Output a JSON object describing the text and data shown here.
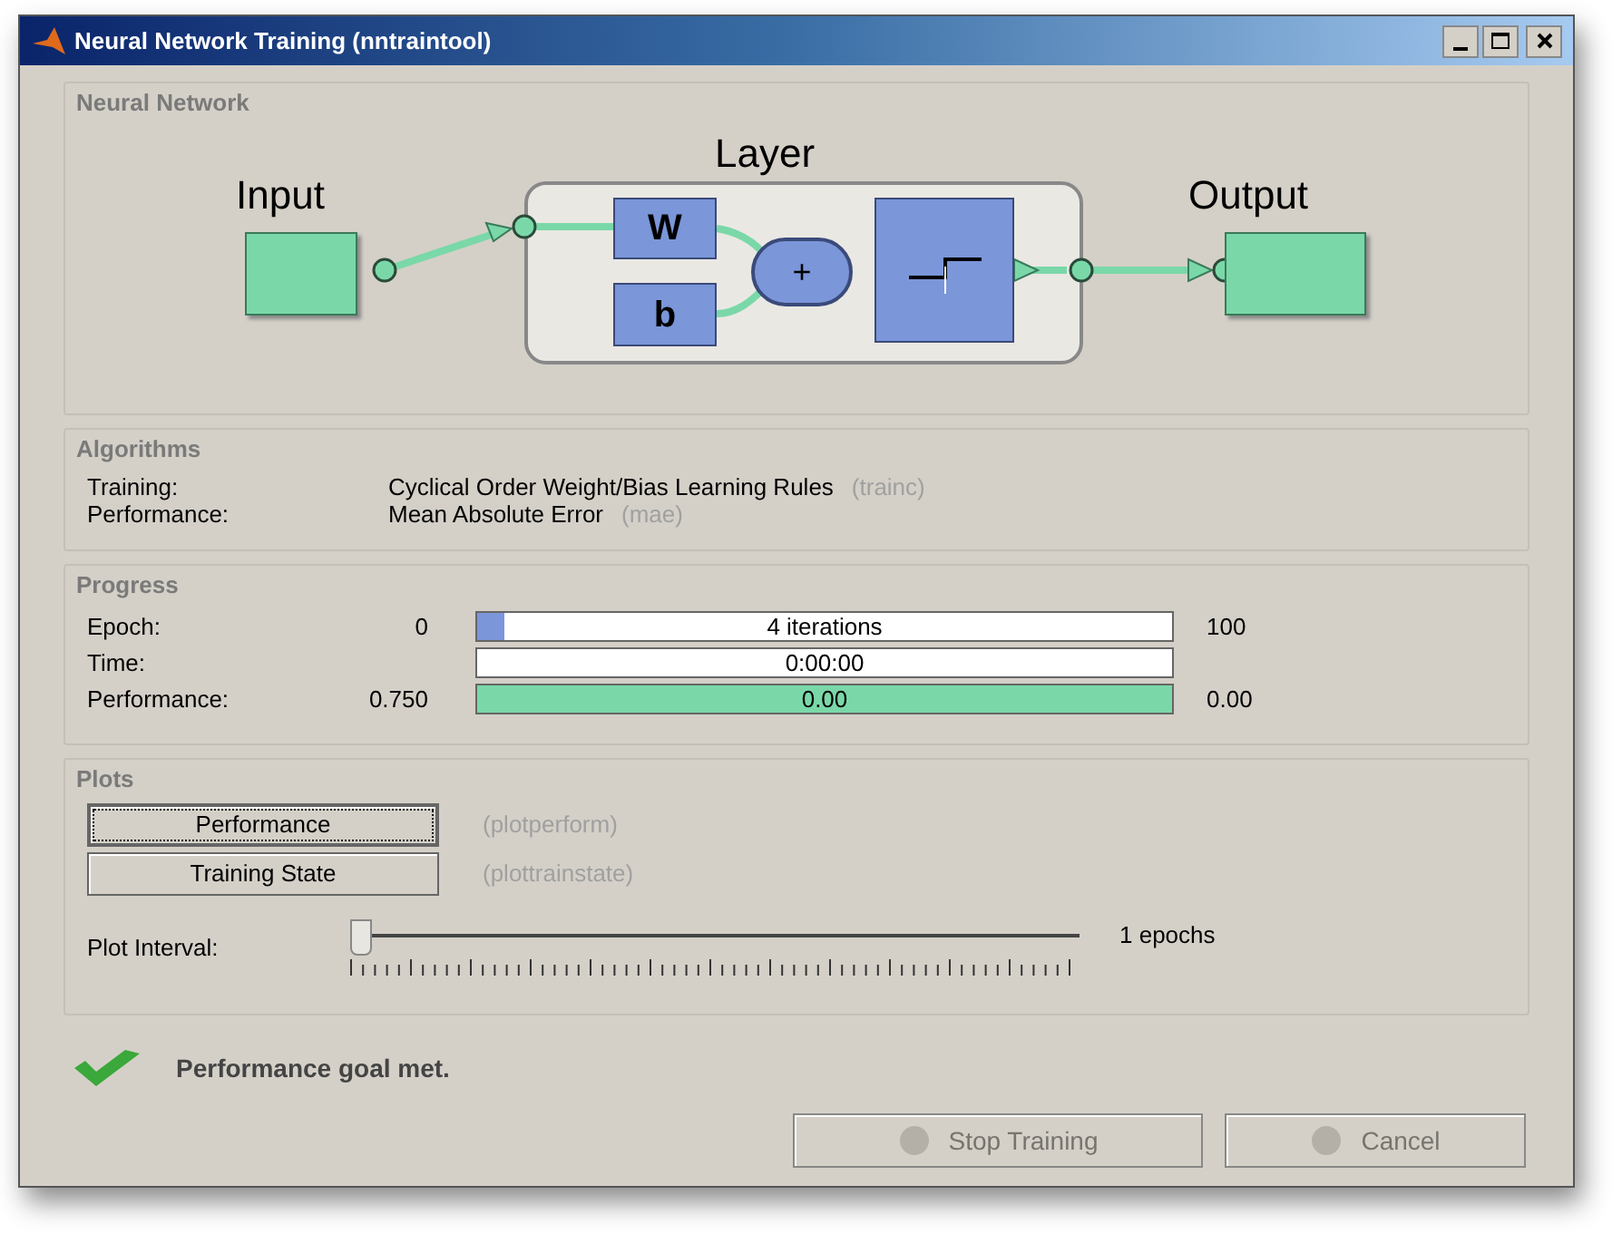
{
  "window": {
    "title": "Neural Network Training (nntraintool)"
  },
  "network": {
    "title": "Neural Network",
    "input_label": "Input",
    "layer_label": "Layer",
    "weight": "W",
    "bias": "b",
    "sum": "+",
    "output_label": "Output"
  },
  "algorithms": {
    "title": "Algorithms",
    "rows": [
      {
        "label": "Training:",
        "value": "Cyclical Order Weight/Bias Learning Rules",
        "code": "(trainc)"
      },
      {
        "label": "Performance:",
        "value": "Mean Absolute Error",
        "code": "(mae)"
      }
    ]
  },
  "progress": {
    "title": "Progress",
    "rows": [
      {
        "kind": "epoch",
        "label": "Epoch:",
        "start": "0",
        "text": "4 iterations",
        "end": "100",
        "level": 0.04
      },
      {
        "kind": "time",
        "label": "Time:",
        "text": "0:00:00"
      },
      {
        "kind": "performance",
        "label": "Performance:",
        "start": "0.750",
        "text": "0.00",
        "end": "0.00",
        "level": 1
      }
    ]
  },
  "plots": {
    "title": "Plots",
    "buttons": [
      {
        "label": "Performance",
        "code": "(plotperform)",
        "focused": true
      },
      {
        "label": "Training State",
        "code": "(plottrainstate)",
        "focused": false
      }
    ],
    "slider": {
      "label": "Plot Interval:",
      "level": 0,
      "reading": "1 epochs"
    }
  },
  "status": {
    "text": "Performance goal met."
  },
  "buttons": [
    {
      "label": "Stop Training",
      "disabled": true
    },
    {
      "label": "Cancel",
      "disabled": true
    }
  ]
}
